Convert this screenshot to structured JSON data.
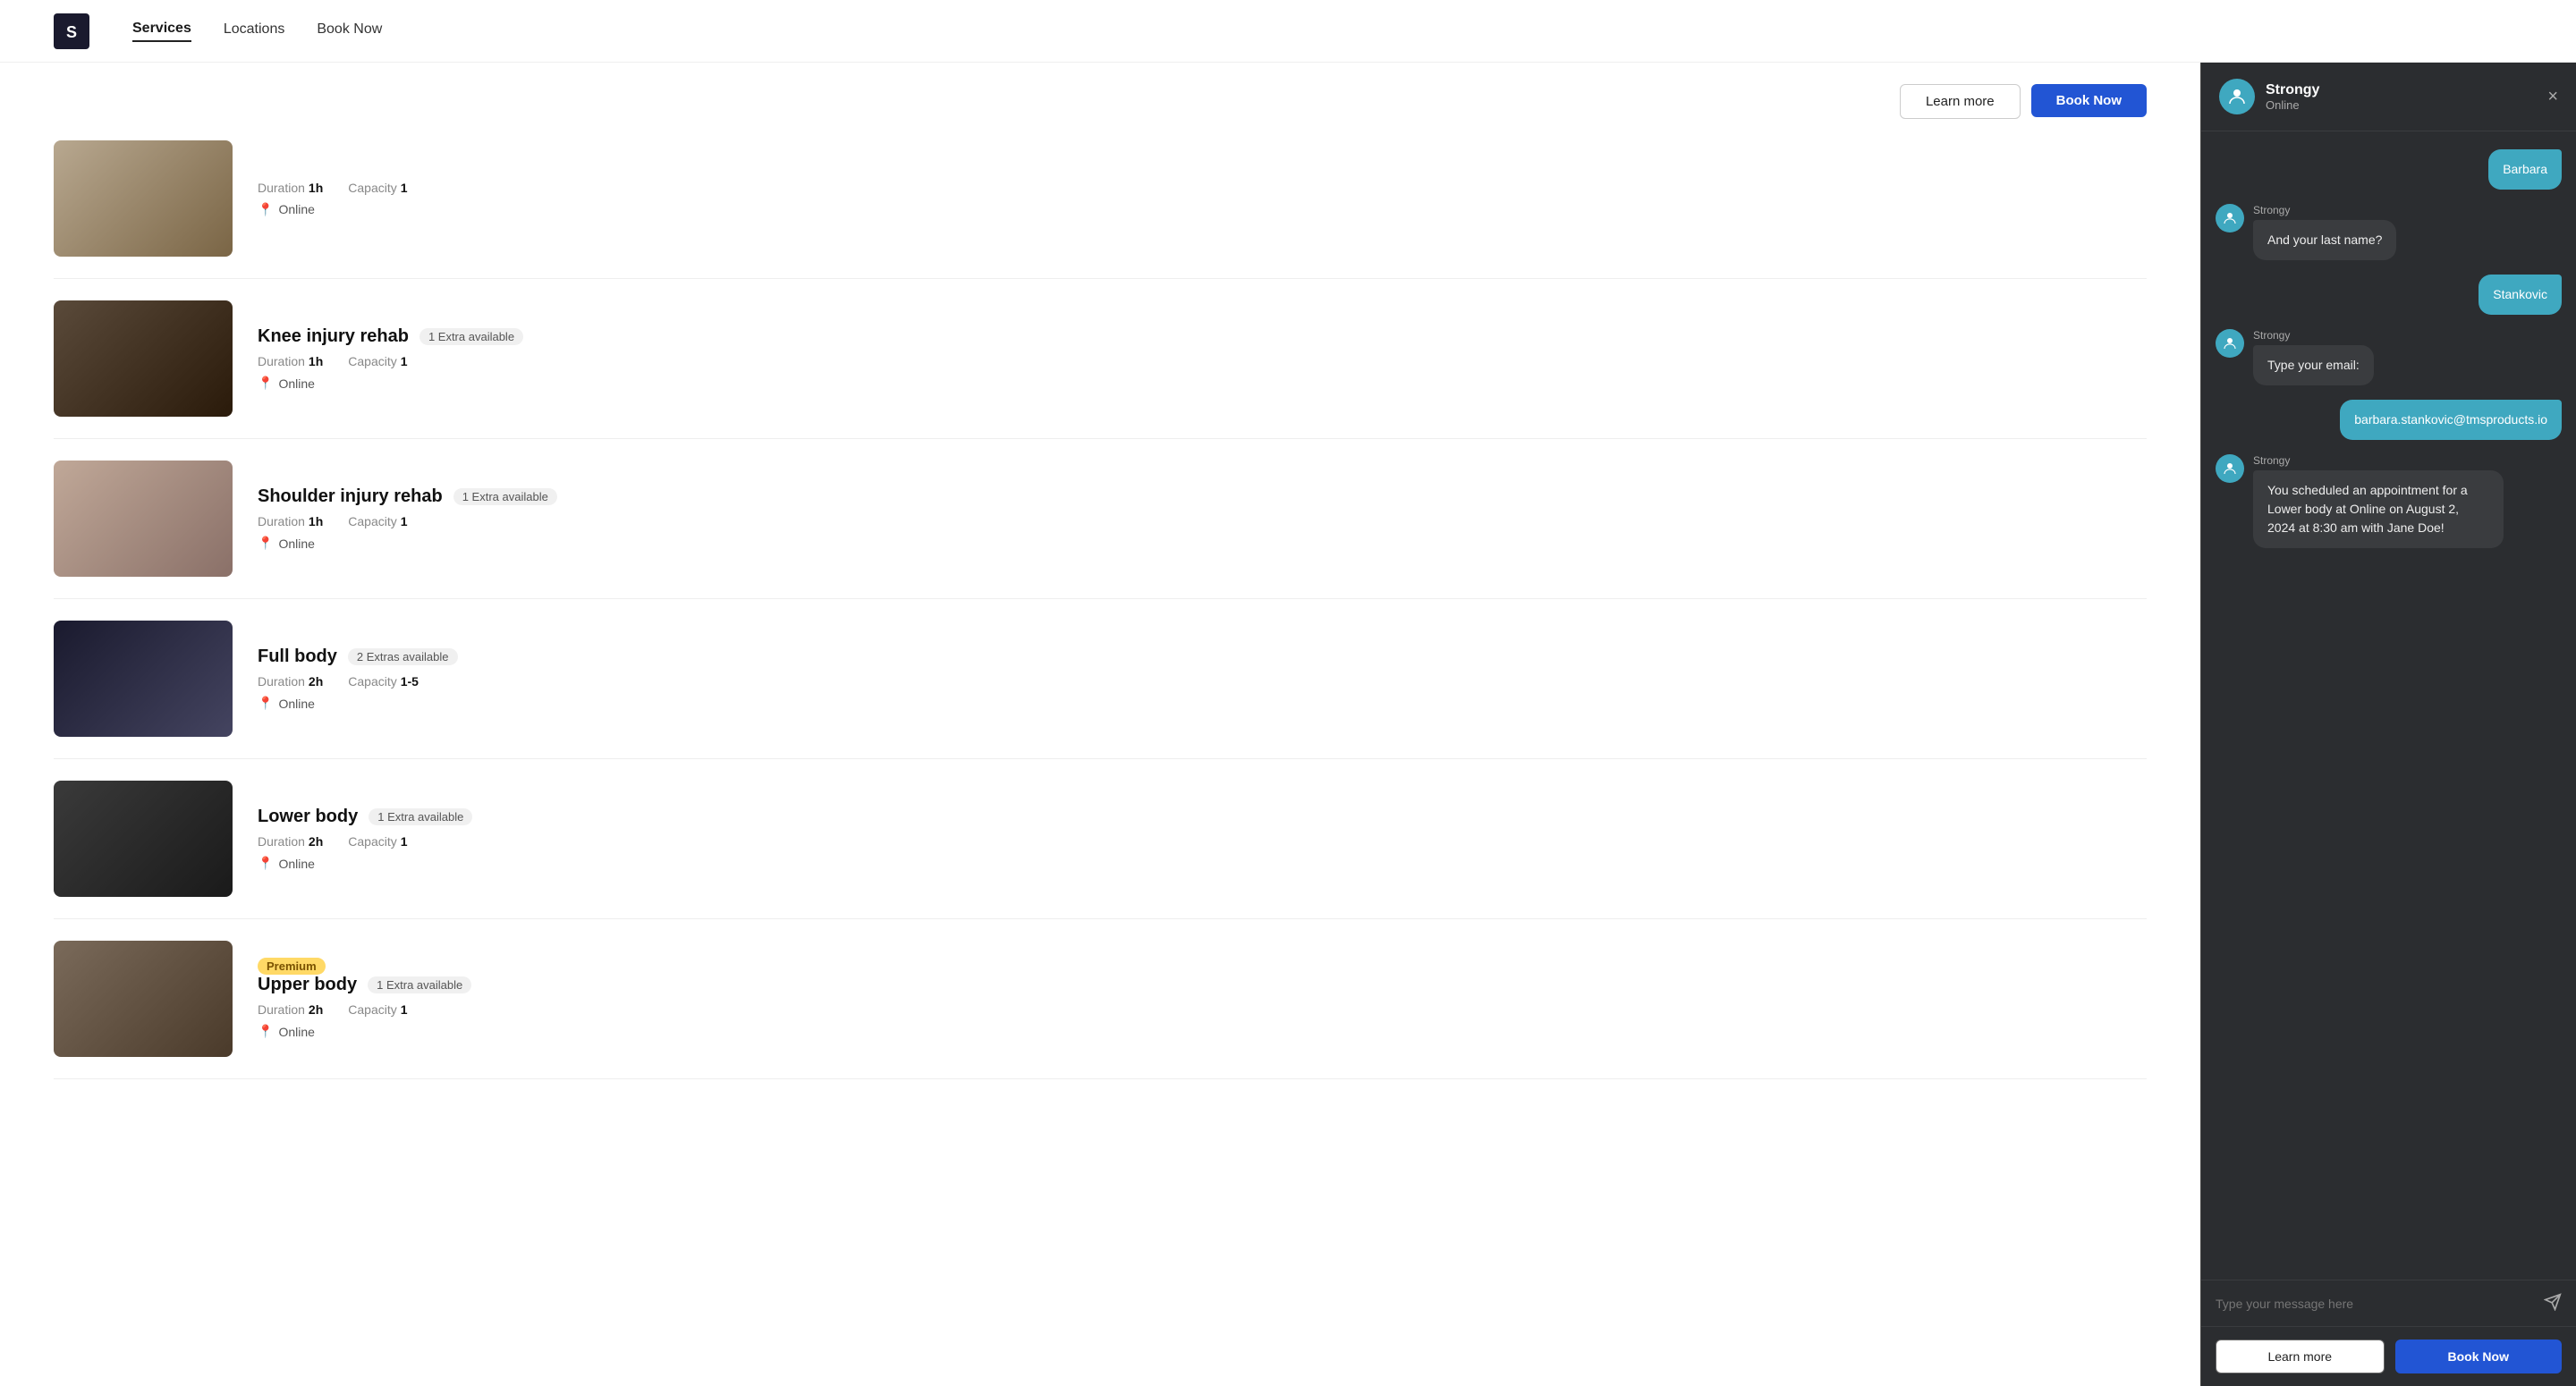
{
  "navbar": {
    "logo_alt": "Strong logo",
    "links": [
      {
        "id": "services",
        "label": "Services",
        "active": true
      },
      {
        "id": "locations",
        "label": "Locations",
        "active": false
      },
      {
        "id": "book-now",
        "label": "Book Now",
        "active": false
      }
    ]
  },
  "top_buttons": {
    "learn_more": "Learn more",
    "book_now": "Book Now"
  },
  "services": [
    {
      "id": "service-0",
      "title": "",
      "extras": "",
      "duration": "1h",
      "capacity": "1",
      "location": "Online",
      "img_class": "img-gym1",
      "premium": false
    },
    {
      "id": "service-1",
      "title": "Knee injury rehab",
      "extras": "1 Extra available",
      "duration": "1h",
      "capacity": "1",
      "location": "Online",
      "img_class": "img-gym2",
      "premium": false
    },
    {
      "id": "service-2",
      "title": "Shoulder injury rehab",
      "extras": "1 Extra available",
      "duration": "1h",
      "capacity": "1",
      "location": "Online",
      "img_class": "img-gym3",
      "premium": false
    },
    {
      "id": "service-3",
      "title": "Full body",
      "extras": "2 Extras available",
      "duration": "2h",
      "capacity": "1-5",
      "location": "Online",
      "img_class": "img-gym4",
      "premium": false
    },
    {
      "id": "service-4",
      "title": "Lower body",
      "extras": "1 Extra available",
      "duration": "2h",
      "capacity": "1",
      "location": "Online",
      "img_class": "img-gym5",
      "premium": false
    },
    {
      "id": "service-5",
      "title": "Upper body",
      "extras": "1 Extra available",
      "duration": "2h",
      "capacity": "1",
      "location": "Online",
      "img_class": "img-gym6",
      "premium": true,
      "premium_label": "Premium"
    }
  ],
  "meta_labels": {
    "duration": "Duration",
    "capacity": "Capacity"
  },
  "chat": {
    "bot_name": "Strongy",
    "bot_status": "Online",
    "close_btn": "×",
    "messages": [
      {
        "id": "m1",
        "type": "user",
        "text": "Barbara",
        "sender": ""
      },
      {
        "id": "m2",
        "type": "bot",
        "sender": "Strongy",
        "text": "And your last name?"
      },
      {
        "id": "m3",
        "type": "user",
        "text": "Stankovic",
        "sender": ""
      },
      {
        "id": "m4",
        "type": "bot",
        "sender": "Strongy",
        "text": "Type your email:"
      },
      {
        "id": "m5",
        "type": "user",
        "text": "barbara.stankovic@tmsproducts.io",
        "sender": ""
      },
      {
        "id": "m6",
        "type": "bot",
        "sender": "Strongy",
        "text": "You scheduled an appointment for a Lower body at Online on August 2, 2024 at 8:30 am with Jane Doe!"
      }
    ],
    "input_placeholder": "Type your message here",
    "footer_learn": "Learn more",
    "footer_book": "Book Now"
  }
}
